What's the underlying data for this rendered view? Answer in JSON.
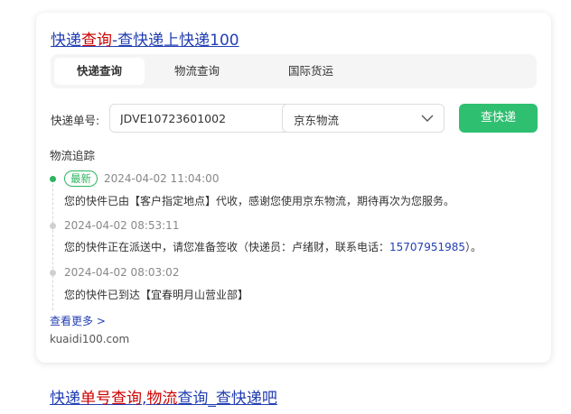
{
  "result1": {
    "title_parts": [
      "快递",
      "查询",
      "-查快递上快递100"
    ],
    "tabs": [
      "快递查询",
      "物流查询",
      "国际货运"
    ],
    "form": {
      "label": "快递单号:",
      "tracking_number": "JDVE10723601002",
      "carrier": "京东物流",
      "query_button": "查快递"
    },
    "tracking": {
      "heading": "物流追踪",
      "latest_badge": "最新",
      "events": [
        {
          "time": "2024-04-02 11:04:00",
          "desc": "您的快件已由【客户指定地点】代收，感谢您使用京东物流，期待再次为您服务。"
        },
        {
          "time": "2024-04-02 08:53:11",
          "desc_before": "您的快件正在派送中，请您准备签收（快递员：卢绪财，联系电话：",
          "phone": "15707951985",
          "desc_after": "）。"
        },
        {
          "time": "2024-04-02 08:03:02",
          "desc": "您的快件已到达【宜春明月山营业部】"
        }
      ]
    },
    "more_link": "查看更多 >",
    "source": "kuaidi100.com"
  },
  "result2": {
    "title_parts": [
      "快递",
      "单号查询",
      ",",
      "物流",
      "查询_查快递吧"
    ]
  },
  "colors": {
    "link_blue": "#2440b3",
    "highlight_red": "#cc0000",
    "accent_green": "#2fbf71"
  }
}
